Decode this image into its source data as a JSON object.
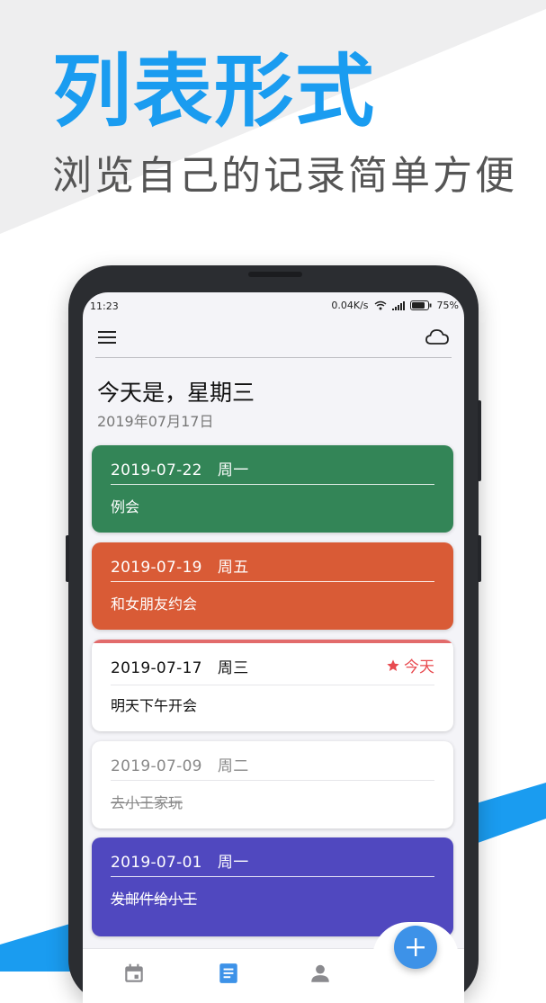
{
  "promo": {
    "headline": "列表形式",
    "subline": "浏览自己的记录简单方便"
  },
  "status_bar": {
    "time": "11:23",
    "network_speed": "0.04K/s",
    "battery": "75%"
  },
  "app_bar": {
    "menu_icon": "menu-icon",
    "sync_icon": "cloud-icon"
  },
  "header": {
    "greeting": "今天是，星期三",
    "date": "2019年07月17日"
  },
  "entries": [
    {
      "date": "2019-07-22",
      "weekday": "周一",
      "text": "例会",
      "color": "#338557",
      "text_color": "#ffffff",
      "done": false,
      "today": false
    },
    {
      "date": "2019-07-19",
      "weekday": "周五",
      "text": "和女朋友约会",
      "color": "#d95b36",
      "text_color": "#ffffff",
      "done": false,
      "today": false
    },
    {
      "date": "2019-07-17",
      "weekday": "周三",
      "text": "明天下午开会",
      "color": "#ffffff",
      "accent": "#e26b6b",
      "text_color": "#111111",
      "done": false,
      "today": true,
      "today_label": "今天"
    },
    {
      "date": "2019-07-09",
      "weekday": "周二",
      "text": "去小王家玩",
      "color": "#ffffff",
      "text_color": "#888888",
      "done": true,
      "today": false
    },
    {
      "date": "2019-07-01",
      "weekday": "周一",
      "text": "发邮件给小王",
      "color": "#5048bf",
      "text_color": "#ffffff",
      "done": true,
      "today": false
    }
  ],
  "bottom_nav": {
    "items": [
      "calendar-icon",
      "list-icon",
      "person-icon"
    ],
    "active": "list-icon",
    "fab_icon": "plus-icon"
  },
  "colors": {
    "brand_blue": "#1a9cf0",
    "fab_blue": "#3d92e8",
    "today_red": "#e84a4f"
  }
}
